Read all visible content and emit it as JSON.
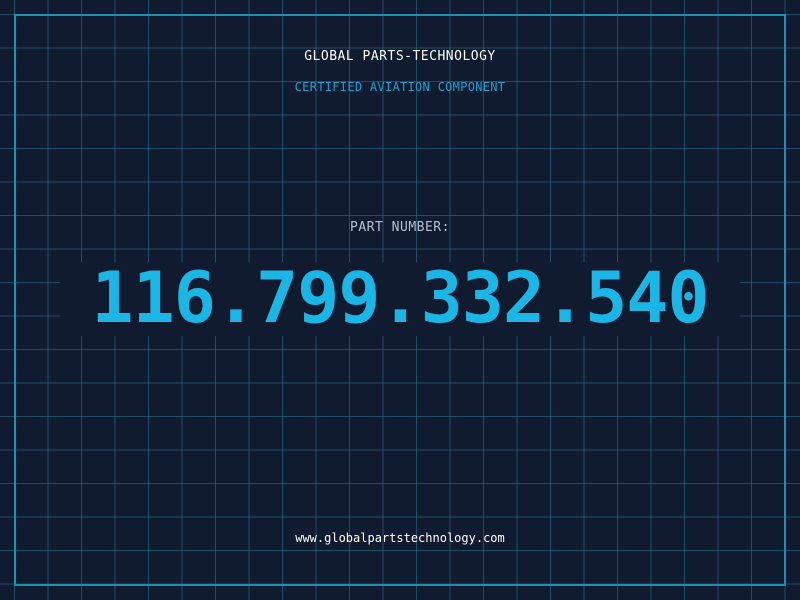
{
  "header": {
    "company": "GLOBAL PARTS-TECHNOLOGY",
    "subtitle": "CERTIFIED AVIATION COMPONENT"
  },
  "part": {
    "label": "PART NUMBER:",
    "number": "116.799.332.540"
  },
  "footer": {
    "url": "www.globalpartstechnology.com"
  },
  "colors": {
    "background": "#111b30",
    "grid": "#28788c",
    "frame": "#1f8fb8",
    "accent": "#19b6e6",
    "subtitle": "#1e9fd0",
    "label": "#b7c0cc",
    "text": "#ffffff"
  }
}
